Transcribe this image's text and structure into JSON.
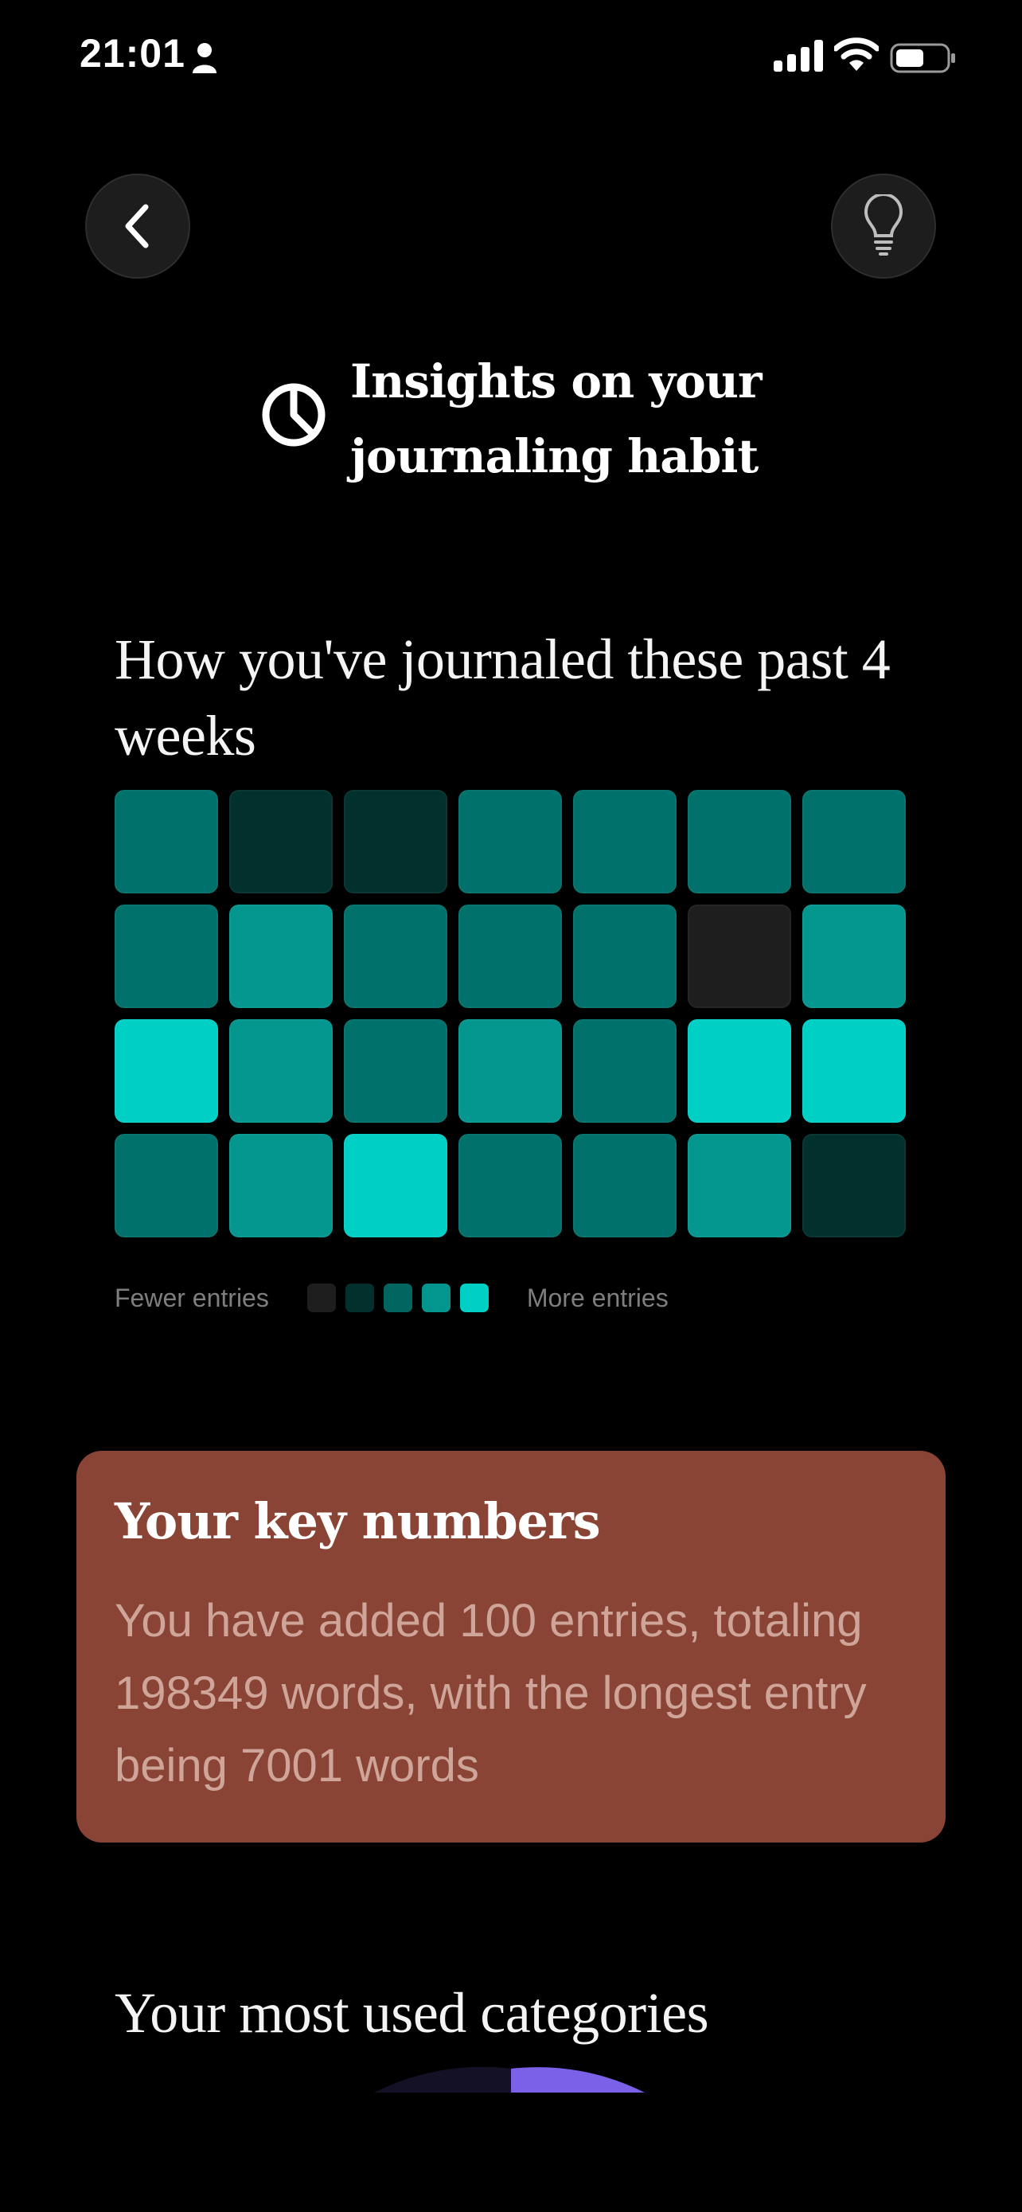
{
  "status_bar": {
    "time": "21:01",
    "icons": [
      "person-icon",
      "cellular-signal-icon",
      "wifi-icon",
      "battery-icon"
    ]
  },
  "header": {
    "back_icon": "chevron-left-icon",
    "tip_icon": "lightbulb-icon",
    "title_icon": "pie-chart-icon",
    "title": "Insights on your journaling habit"
  },
  "weeks": {
    "heading": "How you've journaled these past 4 weeks",
    "levels": [
      [
        3,
        1,
        1,
        3,
        3,
        3,
        3
      ],
      [
        3,
        4,
        3,
        3,
        3,
        0,
        4
      ],
      [
        5,
        4,
        3,
        4,
        3,
        5,
        5
      ],
      [
        3,
        4,
        5,
        3,
        3,
        4,
        1
      ]
    ],
    "level_colors": [
      "#1e1e1e",
      "#02302d",
      "#016560",
      "#00706a",
      "#03968f",
      "#00cfc6"
    ],
    "legend": {
      "fewer_label": "Fewer entries",
      "more_label": "More entries",
      "swatch_colors": [
        "#1e1e1e",
        "#02302d",
        "#016560",
        "#03968f",
        "#00cfc6"
      ]
    }
  },
  "key_numbers": {
    "title": "Your key numbers",
    "body": "You have added 100 entries, totaling 198349 words, with the longest entry being 7001 words",
    "background": "#8a4435"
  },
  "categories": {
    "heading": "Your most used categories",
    "accent": "#7b61e8"
  }
}
